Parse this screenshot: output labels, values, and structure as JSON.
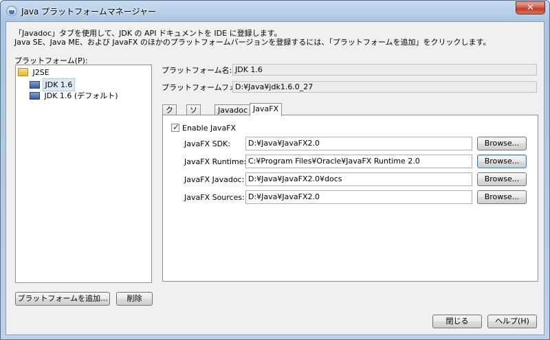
{
  "window": {
    "title": "Java プラットフォームマネージャー",
    "close_label": "✕"
  },
  "description": {
    "line1": "「Javadoc」タブを使用して、JDK の API ドキュメントを IDE に登録します。",
    "line2": "Java SE、Java ME、および JavaFX のほかのプラットフォームバージョンを登録するには、「プラットフォームを追加」をクリックします。"
  },
  "platforms": {
    "label": "プラットフォーム(P):",
    "root": "J2SE",
    "items": [
      {
        "label": "JDK 1.6",
        "selected": true
      },
      {
        "label": "JDK 1.6 (デフォルト)",
        "selected": false
      }
    ]
  },
  "details": {
    "name_label": "プラットフォーム名:",
    "name_value": "JDK 1.6",
    "folder_label": "プラットフォームフォルダ:",
    "folder_value": "D:¥Java¥jdk1.6.0_27"
  },
  "tabs": [
    {
      "label": "クラス",
      "active": false
    },
    {
      "label": "ソース",
      "active": false
    },
    {
      "label": "Javadoc",
      "active": false
    },
    {
      "label": "JavaFX",
      "active": true
    }
  ],
  "javafx": {
    "enable_label": "Enable JavaFX",
    "enable_checked": true,
    "rows": [
      {
        "label": "JavaFX SDK:",
        "value": "D:¥Java¥JavaFX2.0",
        "button": "Browse..."
      },
      {
        "label": "JavaFX Runtime:",
        "value": "C:¥Program Files¥Oracle¥JavaFX Runtime 2.0",
        "button": "Browse..."
      },
      {
        "label": "JavaFX Javadoc:",
        "value": "D:¥Java¥JavaFX2.0¥docs",
        "button": "Browse..."
      },
      {
        "label": "JavaFX Sources:",
        "value": "D:¥Java¥JavaFX2.0",
        "button": "Browse..."
      }
    ]
  },
  "buttons": {
    "add_platform": "プラットフォームを追加...",
    "remove": "削除",
    "close": "閉じる",
    "help": "ヘルプ(H)"
  }
}
